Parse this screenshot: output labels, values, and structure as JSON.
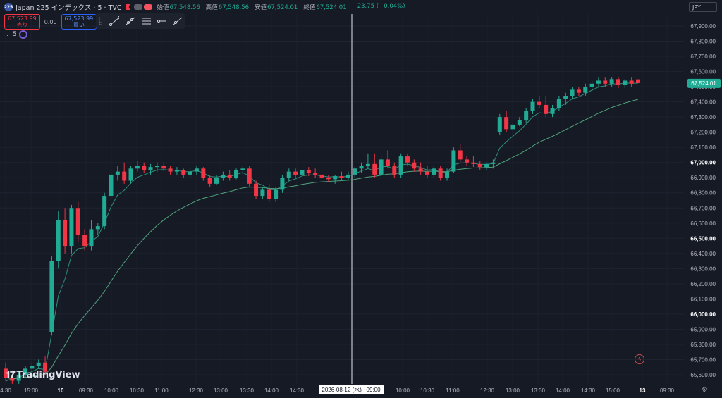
{
  "header": {
    "symbol_badge": "225",
    "title": "Japan 225 インデックス · 5 · TVC",
    "ohlc": [
      {
        "label": "始値",
        "value": "67,548.56"
      },
      {
        "label": "高値",
        "value": "67,548.56"
      },
      {
        "label": "安値",
        "value": "67,524.01"
      },
      {
        "label": "終値",
        "value": "67,524.01"
      },
      {
        "label": "",
        "value": "−23.75 (−0.04%)"
      }
    ]
  },
  "trade": {
    "sell_price": "67,523.99",
    "sell_label": "売り",
    "spread": "0.00",
    "buy_price": "67,523.99",
    "buy_label": "買い"
  },
  "indicator": {
    "label": "5"
  },
  "currency": "JPY",
  "watermark": "TradingView",
  "crosshair_label": "2026-08-12 (水)   09:00",
  "colors": {
    "up": "#22ab94",
    "down": "#f23645",
    "ma": "#4fa37c",
    "background": "#161a25"
  },
  "chart_data": {
    "type": "candlestick",
    "y_ticks": [
      "67,900.00",
      "67,800.00",
      "67,700.00",
      "67,600.00",
      "67,500.00",
      "67,400.00",
      "67,300.00",
      "67,200.00",
      "67,100.00",
      "67,000.00",
      "66,900.00",
      "66,800.00",
      "66,700.00",
      "66,600.00",
      "66,500.00",
      "66,400.00",
      "66,300.00",
      "66,200.00",
      "66,100.00",
      "66,000.00",
      "65,900.00",
      "65,800.00",
      "65,700.00",
      "65,600.00"
    ],
    "y_tick_values": [
      67900,
      67800,
      67700,
      67600,
      67500,
      67400,
      67300,
      67200,
      67100,
      67000,
      66900,
      66800,
      66700,
      66600,
      66500,
      66400,
      66300,
      66200,
      66100,
      66000,
      65900,
      65800,
      65700,
      65600
    ],
    "bold_ticks": [
      "67,000.00",
      "66,500.00",
      "66,000.00"
    ],
    "last_price": "67,524.01",
    "last_price_value": 67524.01,
    "x_ticks": [
      "4:30",
      "15:00",
      "10",
      "09:30",
      "10:00",
      "10:30",
      "11:00",
      "12:30",
      "13:00",
      "13:30",
      "14:00",
      "14:30",
      "09:00",
      "10:00",
      "10:30",
      "11:00",
      "12:30",
      "13:00",
      "13:30",
      "14:00",
      "14:30",
      "15:00",
      "13",
      "09:30"
    ],
    "bold_x_ticks": [
      "10",
      "13"
    ],
    "candles": [
      [
        65640,
        65680,
        65560,
        65580
      ],
      [
        65580,
        65600,
        65540,
        65560
      ],
      [
        65560,
        65620,
        65540,
        65600
      ],
      [
        65600,
        65660,
        65580,
        65640
      ],
      [
        65640,
        65680,
        65600,
        65660
      ],
      [
        65660,
        65700,
        65640,
        65680
      ],
      [
        65680,
        65720,
        65600,
        65620
      ],
      [
        65880,
        66380,
        65860,
        66350
      ],
      [
        66350,
        66680,
        66300,
        66620
      ],
      [
        66620,
        66700,
        66400,
        66450
      ],
      [
        66450,
        66720,
        66400,
        66700
      ],
      [
        66700,
        66740,
        66480,
        66520
      ],
      [
        66520,
        66560,
        66420,
        66450
      ],
      [
        66450,
        66620,
        66420,
        66560
      ],
      [
        66560,
        66600,
        66520,
        66580
      ],
      [
        66580,
        66800,
        66560,
        66780
      ],
      [
        66780,
        66960,
        66760,
        66920
      ],
      [
        66920,
        66980,
        66880,
        66940
      ],
      [
        66940,
        67000,
        66860,
        66880
      ],
      [
        66880,
        66980,
        66860,
        66960
      ],
      [
        66960,
        67010,
        66940,
        66980
      ],
      [
        66980,
        67000,
        66930,
        66950
      ],
      [
        66950,
        66990,
        66920,
        66970
      ],
      [
        66970,
        67000,
        66940,
        66980
      ],
      [
        66980,
        67000,
        66940,
        66960
      ],
      [
        66960,
        66980,
        66920,
        66940
      ],
      [
        66940,
        66970,
        66920,
        66950
      ],
      [
        66950,
        66960,
        66900,
        66920
      ],
      [
        66920,
        66960,
        66900,
        66940
      ],
      [
        66940,
        66980,
        66920,
        66960
      ],
      [
        66960,
        66970,
        66880,
        66900
      ],
      [
        66900,
        66920,
        66840,
        66860
      ],
      [
        66860,
        66920,
        66850,
        66900
      ],
      [
        66900,
        66940,
        66880,
        66920
      ],
      [
        66920,
        66950,
        66880,
        66900
      ],
      [
        66900,
        66960,
        66890,
        66950
      ],
      [
        66950,
        66980,
        66920,
        66960
      ],
      [
        66960,
        66980,
        66840,
        66860
      ],
      [
        66860,
        66880,
        66760,
        66780
      ],
      [
        66780,
        66840,
        66760,
        66820
      ],
      [
        66820,
        66860,
        66740,
        66760
      ],
      [
        66760,
        66840,
        66740,
        66820
      ],
      [
        66820,
        66920,
        66800,
        66900
      ],
      [
        66900,
        66960,
        66880,
        66940
      ],
      [
        66940,
        66960,
        66900,
        66920
      ],
      [
        66920,
        66960,
        66900,
        66950
      ],
      [
        66950,
        66970,
        66910,
        66930
      ],
      [
        66930,
        66960,
        66900,
        66920
      ],
      [
        66920,
        66940,
        66880,
        66900
      ],
      [
        66900,
        66920,
        66870,
        66890
      ],
      [
        66890,
        66920,
        66860,
        66910
      ],
      [
        66910,
        66940,
        66880,
        66900
      ],
      [
        66900,
        66940,
        66880,
        66920
      ],
      [
        66920,
        66970,
        66900,
        66960
      ],
      [
        66960,
        67000,
        66930,
        66980
      ],
      [
        66980,
        67060,
        66960,
        66990
      ],
      [
        66990,
        67060,
        66900,
        66920
      ],
      [
        66920,
        67040,
        66910,
        67020
      ],
      [
        67020,
        67080,
        66960,
        66980
      ],
      [
        66980,
        67000,
        66900,
        66920
      ],
      [
        66920,
        67060,
        66900,
        67040
      ],
      [
        67040,
        67060,
        66980,
        67000
      ],
      [
        67000,
        67020,
        66940,
        66960
      ],
      [
        66960,
        67000,
        66920,
        66940
      ],
      [
        66940,
        66980,
        66900,
        66920
      ],
      [
        66920,
        66980,
        66900,
        66960
      ],
      [
        66960,
        66980,
        66880,
        66900
      ],
      [
        66900,
        66960,
        66880,
        66940
      ],
      [
        66940,
        67100,
        66930,
        67080
      ],
      [
        67080,
        67120,
        67000,
        67020
      ],
      [
        67020,
        67040,
        66980,
        67000
      ],
      [
        67000,
        67040,
        66970,
        66990
      ],
      [
        66990,
        67010,
        66950,
        66970
      ],
      [
        66970,
        67000,
        66950,
        66990
      ],
      [
        66990,
        67020,
        66960,
        67000
      ],
      [
        67200,
        67320,
        67180,
        67300
      ],
      [
        67300,
        67340,
        67200,
        67220
      ],
      [
        67220,
        67260,
        67180,
        67250
      ],
      [
        67250,
        67300,
        67240,
        67280
      ],
      [
        67280,
        67360,
        67260,
        67340
      ],
      [
        67340,
        67420,
        67320,
        67400
      ],
      [
        67400,
        67440,
        67360,
        67380
      ],
      [
        67380,
        67440,
        67300,
        67320
      ],
      [
        67320,
        67380,
        67300,
        67360
      ],
      [
        67360,
        67440,
        67340,
        67420
      ],
      [
        67420,
        67460,
        67380,
        67440
      ],
      [
        67440,
        67500,
        67420,
        67480
      ],
      [
        67480,
        67500,
        67440,
        67460
      ],
      [
        67460,
        67520,
        67440,
        67500
      ],
      [
        67500,
        67540,
        67480,
        67520
      ],
      [
        67520,
        67560,
        67500,
        67540
      ],
      [
        67540,
        67560,
        67500,
        67520
      ],
      [
        67520,
        67560,
        67500,
        67550
      ],
      [
        67550,
        67560,
        67490,
        67510
      ],
      [
        67510,
        67550,
        67490,
        67540
      ],
      [
        67540,
        67560,
        67500,
        67520
      ],
      [
        67548.56,
        67548.56,
        67524.01,
        67524.01
      ]
    ]
  }
}
